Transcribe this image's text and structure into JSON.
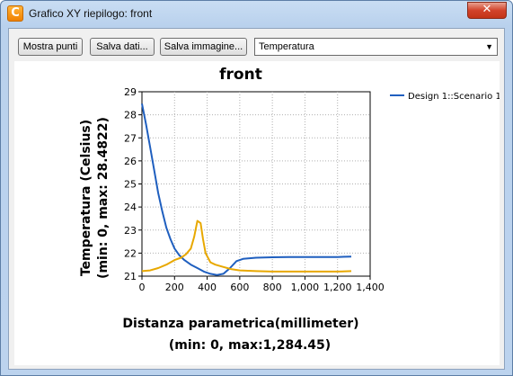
{
  "window": {
    "title": "Grafico XY riepilogo: front",
    "close_glyph": "✕",
    "app_icon_letter": "C"
  },
  "toolbar": {
    "show_points": "Mostra punti",
    "save_data": "Salva dati...",
    "save_image": "Salva immagine...",
    "quantity_select": "Temperatura"
  },
  "chart_data": {
    "type": "line",
    "title": "front",
    "xlabel": "Distanza parametrica(millimeter)",
    "xlabel_sub": "(min: 0, max:1,284.45)",
    "ylabel": "Temperatura  (Celsius)",
    "ylabel_sub": "(min: 0, max: 28.4822)",
    "xlim": [
      0,
      1400
    ],
    "ylim": [
      21,
      29
    ],
    "x_ticks": [
      "0",
      "200",
      "400",
      "600",
      "800",
      "1,000",
      "1,200",
      "1,400"
    ],
    "y_ticks": [
      "21",
      "22",
      "23",
      "24",
      "25",
      "26",
      "27",
      "28",
      "29"
    ],
    "grid": true,
    "legend_position": "top-right",
    "series": [
      {
        "name": "Design 1::Scenario 1",
        "color": "#1f5fbf",
        "x": [
          0,
          25,
          50,
          75,
          100,
          125,
          150,
          175,
          200,
          230,
          260,
          300,
          340,
          380,
          420,
          460,
          500,
          540,
          580,
          620,
          700,
          800,
          900,
          1000,
          1100,
          1200,
          1284
        ],
        "y": [
          28.48,
          27.6,
          26.6,
          25.6,
          24.6,
          23.8,
          23.1,
          22.6,
          22.2,
          21.9,
          21.7,
          21.5,
          21.35,
          21.2,
          21.1,
          21.05,
          21.1,
          21.35,
          21.65,
          21.75,
          21.8,
          21.82,
          21.83,
          21.83,
          21.83,
          21.83,
          21.85
        ]
      },
      {
        "name": "",
        "color": "#e8a800",
        "x": [
          0,
          50,
          100,
          150,
          200,
          240,
          270,
          300,
          320,
          340,
          360,
          375,
          390,
          420,
          450,
          500,
          550,
          600,
          700,
          800,
          900,
          1000,
          1100,
          1200,
          1284
        ],
        "y": [
          21.22,
          21.25,
          21.35,
          21.5,
          21.7,
          21.8,
          21.95,
          22.2,
          22.7,
          23.4,
          23.3,
          22.6,
          22.0,
          21.6,
          21.5,
          21.4,
          21.3,
          21.25,
          21.22,
          21.2,
          21.2,
          21.2,
          21.2,
          21.2,
          21.22
        ]
      }
    ]
  }
}
